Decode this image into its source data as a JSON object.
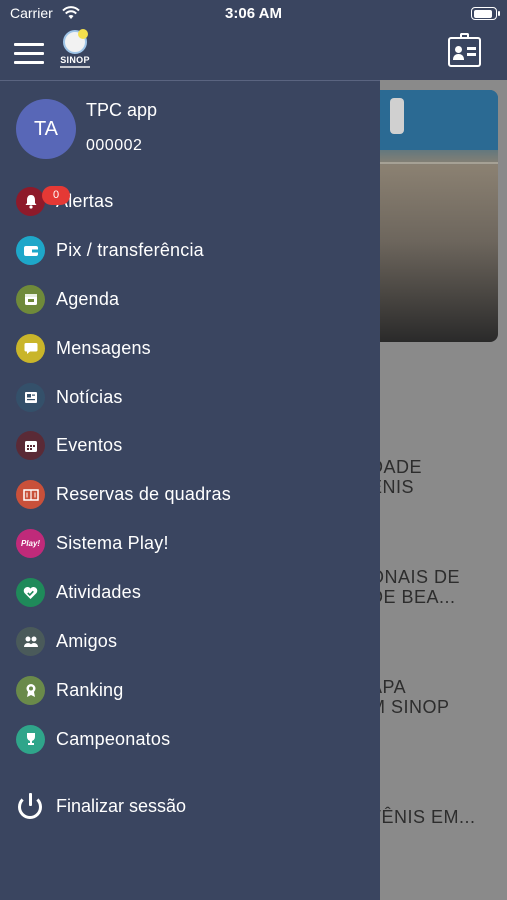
{
  "status_bar": {
    "carrier": "Carrier",
    "time": "3:06 AM"
  },
  "app_bar": {
    "logo_text": "SINOP"
  },
  "profile": {
    "initials": "TA",
    "name": "TPC app",
    "id": "000002"
  },
  "menu": [
    {
      "label": "Alertas",
      "icon": "bell-icon",
      "color": "#8e1a2a",
      "badge": "0"
    },
    {
      "label": "Pix / transferência",
      "icon": "wallet-icon",
      "color": "#1ea7c9"
    },
    {
      "label": "Agenda",
      "icon": "calendar-icon",
      "color": "#6f8a3a"
    },
    {
      "label": "Mensagens",
      "icon": "chat-icon",
      "color": "#c9b52a"
    },
    {
      "label": "Notícias",
      "icon": "newspaper-icon",
      "color": "#34506a"
    },
    {
      "label": "Eventos",
      "icon": "event-calendar-icon",
      "color": "#5a2a36"
    },
    {
      "label": "Reservas de quadras",
      "icon": "court-icon",
      "color": "#c9503a"
    },
    {
      "label": "Sistema Play!",
      "icon": "play-badge-icon",
      "color": "#c02a7a",
      "icon_text": "Play!"
    },
    {
      "label": "Atividades",
      "icon": "heart-check-icon",
      "color": "#1f8a5a"
    },
    {
      "label": "Amigos",
      "icon": "friends-icon",
      "color": "#4a5a5a"
    },
    {
      "label": "Ranking",
      "icon": "medal-icon",
      "color": "#6a8a4a"
    },
    {
      "label": "Campeonatos",
      "icon": "trophy-icon",
      "color": "#2fa58a"
    }
  ],
  "logout": {
    "label": "Finalizar sessão"
  },
  "background_news": [
    {
      "line1": "DADE",
      "line2": "ÊNIS"
    },
    {
      "line1": "ONAIS DE",
      "line2": "DE BEA..."
    },
    {
      "line1": "APA",
      "line2": "M SINOP"
    },
    {
      "line1": "TÊNIS EM..."
    }
  ]
}
